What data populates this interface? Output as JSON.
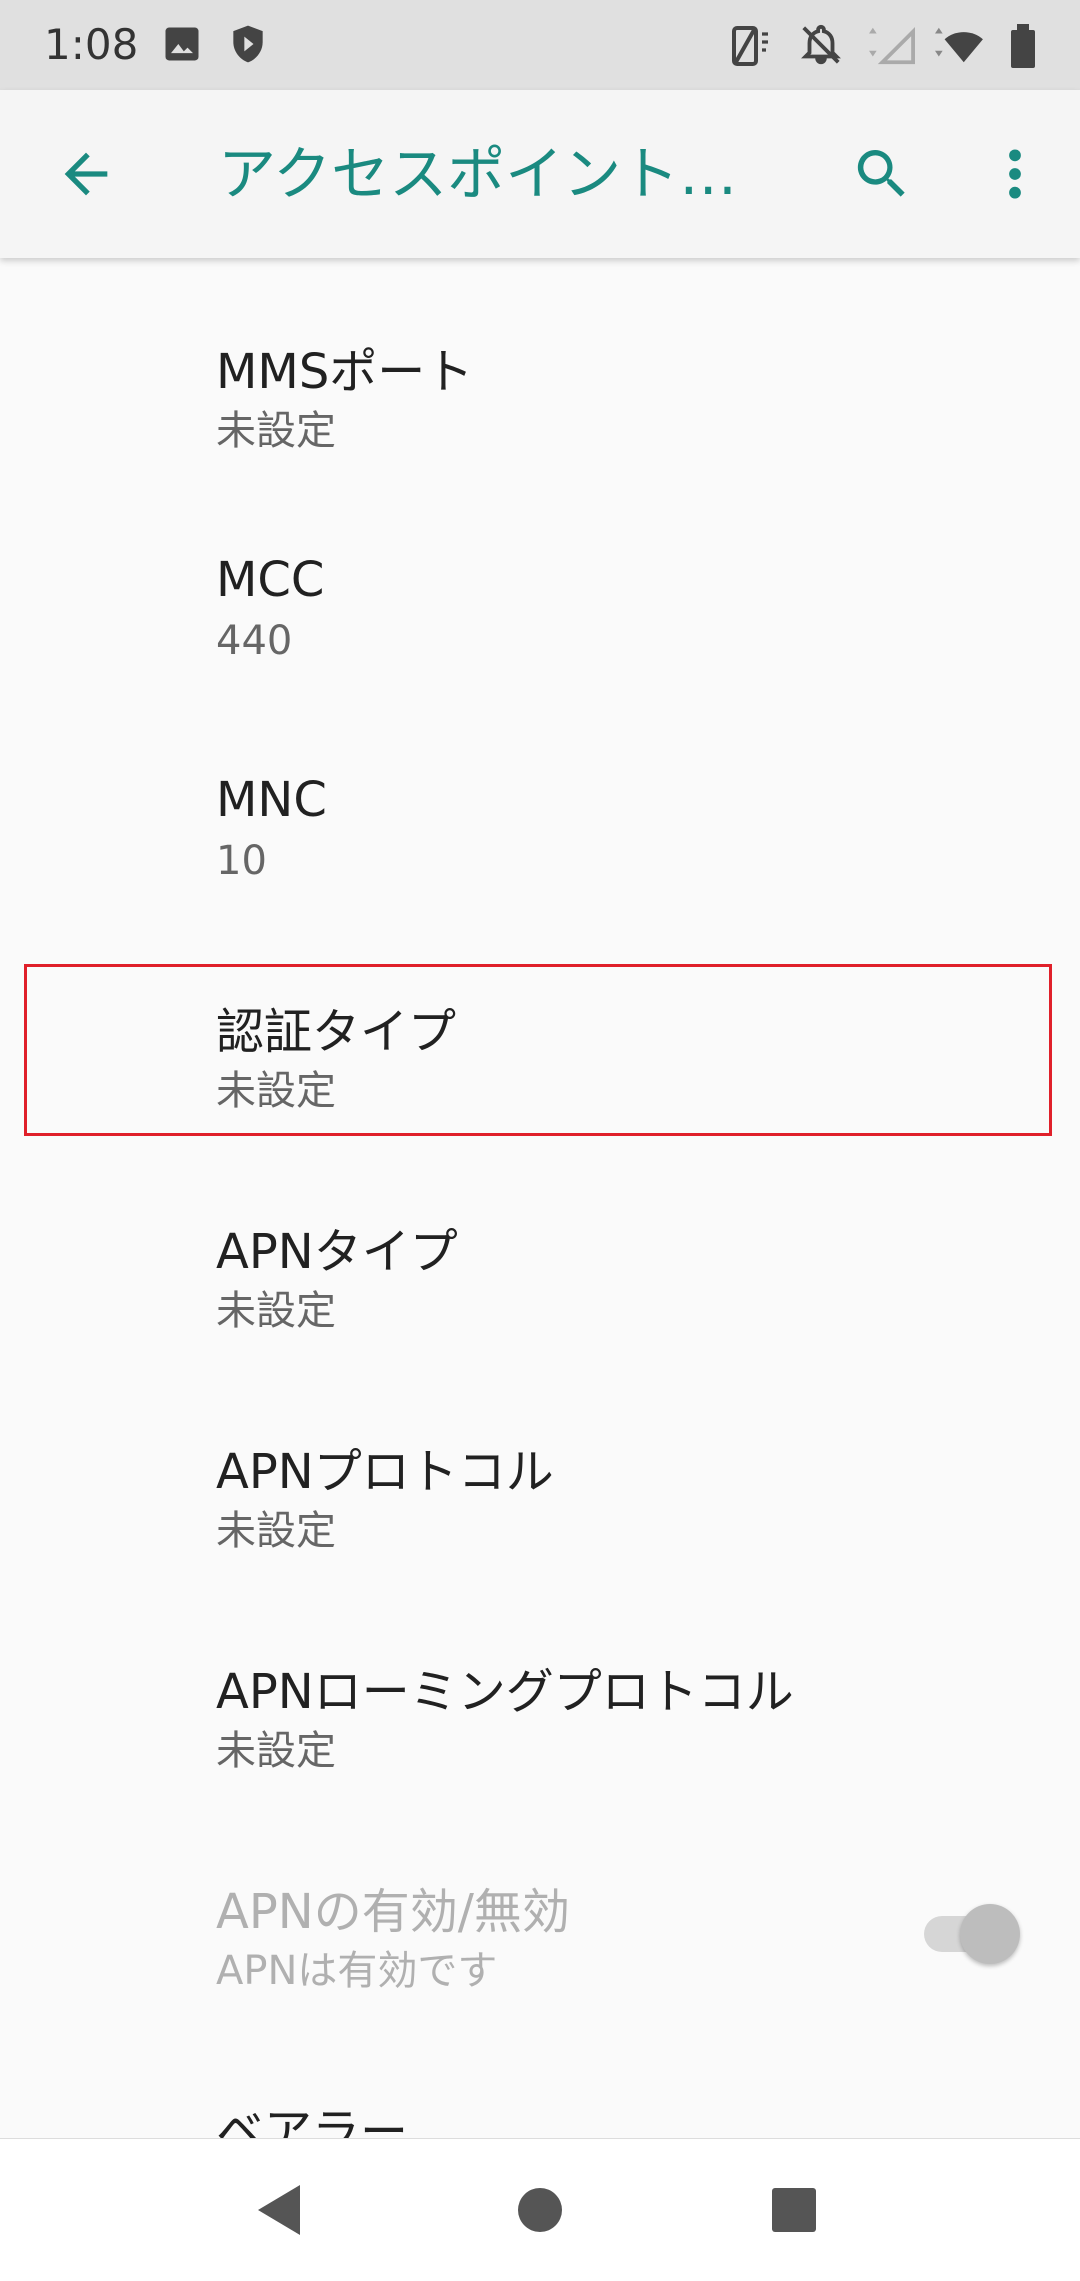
{
  "status_bar": {
    "time": "1:08"
  },
  "app_bar": {
    "title": "アクセスポイント…",
    "accent_color": "#1a8a80"
  },
  "items": [
    {
      "title": "MMSポート",
      "subtitle": "未設定"
    },
    {
      "title": "MCC",
      "subtitle": "440"
    },
    {
      "title": "MNC",
      "subtitle": "10"
    },
    {
      "title": "認証タイプ",
      "subtitle": "未設定"
    },
    {
      "title": "APNタイプ",
      "subtitle": "未設定"
    },
    {
      "title": "APNプロトコル",
      "subtitle": "未設定"
    },
    {
      "title": "APNローミングプロトコル",
      "subtitle": "未設定"
    },
    {
      "title": "APNの有効/無効",
      "subtitle": "APNは有効です",
      "toggle": true
    },
    {
      "title": "ベアラー",
      "subtitle": ""
    }
  ],
  "highlight_color": "#e0202a"
}
